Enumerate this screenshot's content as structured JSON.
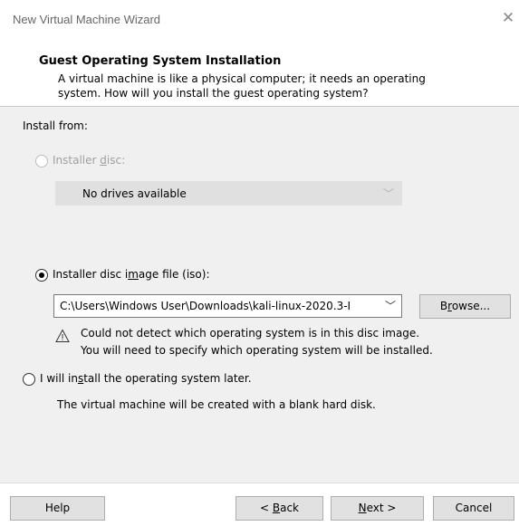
{
  "window": {
    "title": "New Virtual Machine Wizard",
    "close_glyph": "✕"
  },
  "header": {
    "title": "Guest Operating System Installation",
    "description_line1": "A virtual machine is like a physical computer; it needs an operating",
    "description_line2": "system. How will you install the guest operating system?"
  },
  "install_from_label": "Install from:",
  "options": {
    "installer_disc": {
      "label_pre": "Installer ",
      "label_accel": "d",
      "label_post": "isc:",
      "selected": false,
      "enabled": false,
      "dropdown_value": "No drives available"
    },
    "iso": {
      "label_pre": "Installer disc i",
      "label_accel": "m",
      "label_post": "age file (iso):",
      "selected": true,
      "path_value": "C:\\Users\\Windows User\\Downloads\\kali-linux-2020.3-I",
      "browse_pre": "B",
      "browse_accel": "r",
      "browse_post": "owse...",
      "warning_line1": "Could not detect which operating system is in this disc image.",
      "warning_line2": "You will need to specify which operating system will be installed."
    },
    "later": {
      "label_pre": "I will in",
      "label_accel": "s",
      "label_post": "tall the operating system later.",
      "selected": false,
      "note": "The virtual machine will be created with a blank hard disk."
    }
  },
  "footer": {
    "help_label": "Help",
    "back_pre": "< ",
    "back_accel": "B",
    "back_post": "ack",
    "next_accel": "N",
    "next_post": "ext >",
    "cancel_label": "Cancel"
  },
  "colors": {
    "panel_bg": "#f0f0f0",
    "button_bg": "#e1e1e1",
    "disabled_text": "#a0a0a0"
  },
  "icons": [
    "close-icon",
    "chevron-down-icon",
    "warning-icon"
  ]
}
